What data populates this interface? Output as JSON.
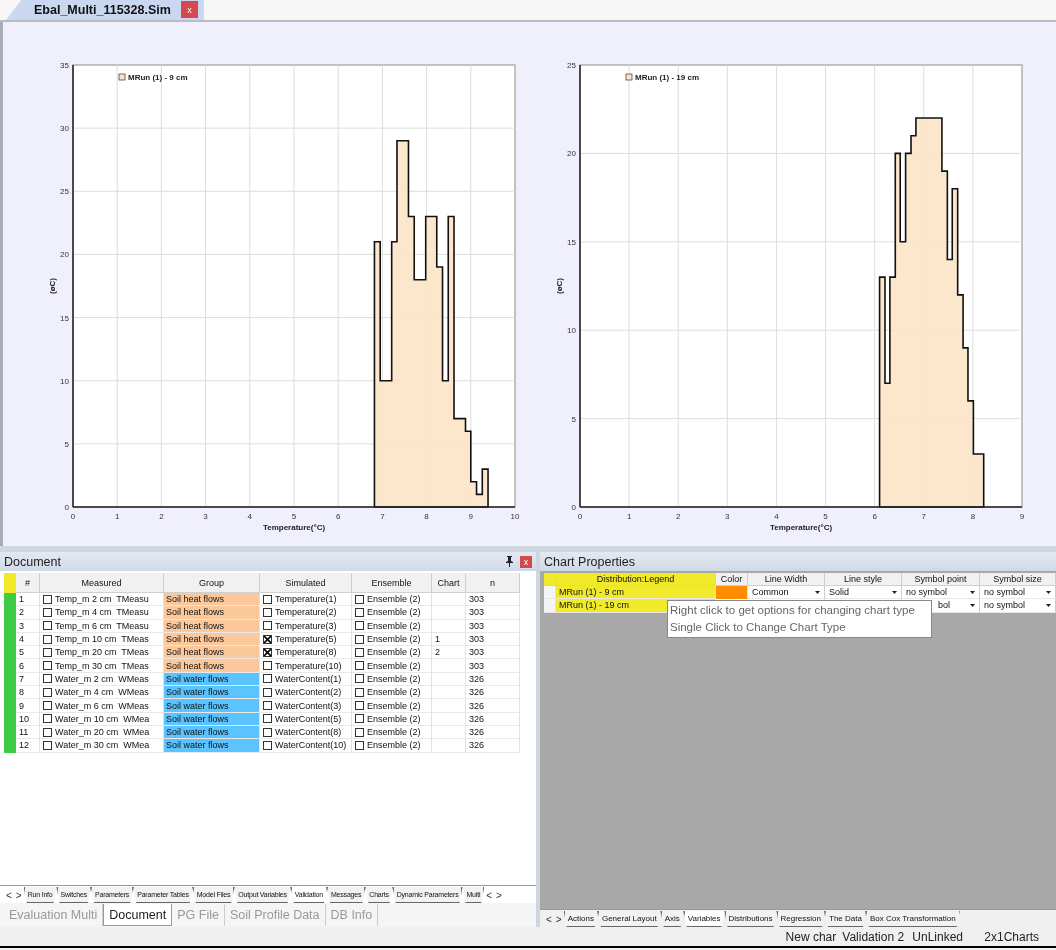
{
  "document_tab": {
    "title": "Ebal_Multi_115328.Sim",
    "close": "x"
  },
  "charts": [
    {
      "chart_data": {
        "type": "area",
        "xlabel": "Temperature(°C)",
        "ylabel": "(øC)",
        "grid": true,
        "xlim": [
          0,
          10
        ],
        "ylim": [
          0,
          35
        ],
        "xticks": [
          0,
          1,
          2,
          3,
          4,
          5,
          6,
          7,
          8,
          9,
          10
        ],
        "yticks": [
          0,
          5,
          10,
          15,
          20,
          25,
          30,
          35
        ],
        "x": [
          6.82,
          6.95,
          7.08,
          7.21,
          7.33,
          7.46,
          7.59,
          7.72,
          7.85,
          7.98,
          8.1,
          8.23,
          8.36,
          8.49,
          8.62,
          8.75,
          8.88,
          9.0,
          9.13,
          9.26,
          9.39
        ],
        "series": [
          {
            "name": "MRun (1) - 9 cm",
            "color": "#fde4c6",
            "values": [
              21,
              10,
              10,
              21,
              29,
              29,
              23,
              18,
              18,
              23,
              23,
              19,
              10,
              23,
              7,
              7,
              6,
              2,
              1,
              3,
              3
            ]
          }
        ]
      }
    },
    {
      "chart_data": {
        "type": "area",
        "xlabel": "Temperature(°C)",
        "ylabel": "(øC)",
        "grid": true,
        "xlim": [
          0,
          9
        ],
        "ylim": [
          0,
          25
        ],
        "xticks": [
          0,
          1,
          2,
          3,
          4,
          5,
          6,
          7,
          8,
          9
        ],
        "yticks": [
          0,
          5,
          10,
          15,
          20,
          25
        ],
        "x": [
          6.1,
          6.21,
          6.31,
          6.42,
          6.52,
          6.63,
          6.74,
          6.84,
          6.95,
          7.05,
          7.16,
          7.27,
          7.37,
          7.48,
          7.58,
          7.69,
          7.8,
          7.9,
          8.01,
          8.11,
          8.22
        ],
        "series": [
          {
            "name": "MRun (1) - 19 cm",
            "color": "#fde4c6",
            "values": [
              13,
              7,
              13,
              20,
              15,
              20,
              21,
              22,
              22,
              22,
              22,
              22,
              19,
              14,
              18,
              12,
              9,
              6,
              3,
              3,
              3
            ]
          }
        ]
      }
    }
  ],
  "document_panel": {
    "title": "Document",
    "close": "x",
    "columns": [
      "#",
      "Measured",
      "Group",
      "Simulated",
      "Ensemble",
      "Chart",
      "n"
    ],
    "rows": [
      {
        "num": "1",
        "measured": "Temp_m 2 cm  TMeasu",
        "measured_checked": false,
        "group": "Soil heat flows",
        "color": "#fbc89b",
        "simulated": "Temperature(1)",
        "simulated_checked": false,
        "ensemble": "Ensemble (2)",
        "ensemble_checked": false,
        "chart": "",
        "n": "303"
      },
      {
        "num": "2",
        "measured": "Temp_m 4 cm  TMeasu",
        "measured_checked": false,
        "group": "Soil heat flows",
        "color": "#fbc89b",
        "simulated": "Temperature(2)",
        "simulated_checked": false,
        "ensemble": "Ensemble (2)",
        "ensemble_checked": false,
        "chart": "",
        "n": "303"
      },
      {
        "num": "3",
        "measured": "Temp_m 6 cm  TMeasu",
        "measured_checked": false,
        "group": "Soil heat flows",
        "color": "#fbc89b",
        "simulated": "Temperature(3)",
        "simulated_checked": false,
        "ensemble": "Ensemble (2)",
        "ensemble_checked": false,
        "chart": "",
        "n": "303"
      },
      {
        "num": "4",
        "measured": "Temp_m 10 cm  TMeas",
        "measured_checked": false,
        "group": "Soil heat flows",
        "color": "#fbc89b",
        "simulated": "Temperature(5)",
        "simulated_checked": true,
        "ensemble": "Ensemble (2)",
        "ensemble_checked": false,
        "chart": "1",
        "n": "303"
      },
      {
        "num": "5",
        "measured": "Temp_m 20 cm  TMeas",
        "measured_checked": false,
        "group": "Soil heat flows",
        "color": "#fbc89b",
        "simulated": "Temperature(8)",
        "simulated_checked": true,
        "ensemble": "Ensemble (2)",
        "ensemble_checked": false,
        "chart": "2",
        "n": "303"
      },
      {
        "num": "6",
        "measured": "Temp_m 30 cm  TMeas",
        "measured_checked": false,
        "group": "Soil heat flows",
        "color": "#fbc89b",
        "simulated": "Temperature(10)",
        "simulated_checked": false,
        "ensemble": "Ensemble (2)",
        "ensemble_checked": false,
        "chart": "",
        "n": "303"
      },
      {
        "num": "7",
        "measured": "Water_m 2 cm  WMeas",
        "measured_checked": false,
        "group": "Soil water flows",
        "color": "#5bc3ff",
        "simulated": "WaterContent(1)",
        "simulated_checked": false,
        "ensemble": "Ensemble (2)",
        "ensemble_checked": false,
        "chart": "",
        "n": "326"
      },
      {
        "num": "8",
        "measured": "Water_m 4 cm  WMeas",
        "measured_checked": false,
        "group": "Soil water flows",
        "color": "#5bc3ff",
        "simulated": "WaterContent(2)",
        "simulated_checked": false,
        "ensemble": "Ensemble (2)",
        "ensemble_checked": false,
        "chart": "",
        "n": "326"
      },
      {
        "num": "9",
        "measured": "Water_m 6 cm  WMeas",
        "measured_checked": false,
        "group": "Soil water flows",
        "color": "#5bc3ff",
        "simulated": "WaterContent(3)",
        "simulated_checked": false,
        "ensemble": "Ensemble (2)",
        "ensemble_checked": false,
        "chart": "",
        "n": "326"
      },
      {
        "num": "10",
        "measured": "Water_m 10 cm  WMea",
        "measured_checked": false,
        "group": "Soil water flows",
        "color": "#5bc3ff",
        "simulated": "WaterContent(5)",
        "simulated_checked": false,
        "ensemble": "Ensemble (2)",
        "ensemble_checked": false,
        "chart": "",
        "n": "326"
      },
      {
        "num": "11",
        "measured": "Water_m 20 cm  WMea",
        "measured_checked": false,
        "group": "Soil water flows",
        "color": "#5bc3ff",
        "simulated": "WaterContent(8)",
        "simulated_checked": false,
        "ensemble": "Ensemble (2)",
        "ensemble_checked": false,
        "chart": "",
        "n": "326"
      },
      {
        "num": "12",
        "measured": "Water_m 30 cm  WMea",
        "measured_checked": false,
        "group": "Soil water flows",
        "color": "#5bc3ff",
        "simulated": "WaterContent(10)",
        "simulated_checked": false,
        "ensemble": "Ensemble (2)",
        "ensemble_checked": false,
        "chart": "",
        "n": "326"
      }
    ],
    "sheet_nav": [
      "<",
      ">"
    ],
    "sheet_tabs": [
      {
        "label": "Run Info",
        "selected": false
      },
      {
        "label": "Switches",
        "selected": false
      },
      {
        "label": "Parameters",
        "selected": false
      },
      {
        "label": "Parameter Tables",
        "selected": false
      },
      {
        "label": "Model Files",
        "selected": false
      },
      {
        "label": "Output Variables",
        "selected": false
      },
      {
        "label": "Validation",
        "selected": true
      },
      {
        "label": "Messages",
        "selected": false
      },
      {
        "label": "Charts",
        "selected": false
      },
      {
        "label": "Dynamic Parameters",
        "selected": false
      },
      {
        "label": "Multi",
        "selected": false
      }
    ],
    "sheet_end_nav": [
      "<",
      ">"
    ],
    "panel_tabs": [
      {
        "label": "Evaluation Multi",
        "selected": false
      },
      {
        "label": "Document",
        "selected": true
      },
      {
        "label": "PG File",
        "selected": false
      },
      {
        "label": "Soil Profile Data",
        "selected": false
      },
      {
        "label": "DB Info",
        "selected": false
      }
    ]
  },
  "chart_properties": {
    "title": "Chart Properties",
    "columns": [
      "Distribution:Legend",
      "Color",
      "Line Width",
      "Line style",
      "Symbol point",
      "Symbol size"
    ],
    "rows": [
      {
        "legend": "MRun (1) - 9 cm",
        "color": "#ff8c00",
        "line_width": "Common",
        "line_style": "Solid",
        "symbol_point": "no symbol",
        "symbol_size": "no symbol"
      },
      {
        "legend": "MRun (1) - 19 cm",
        "symbol_point": "bol",
        "symbol_size": "no symbol"
      }
    ],
    "tooltip": [
      "Right click to get options for changing chart type",
      "Single Click to Change Chart Type"
    ],
    "tab_nav": [
      "<",
      ">"
    ],
    "tabs": [
      {
        "label": "Actions",
        "selected": false
      },
      {
        "label": "General Layout",
        "selected": false
      },
      {
        "label": "Axis",
        "selected": false
      },
      {
        "label": "Variables",
        "selected": true
      },
      {
        "label": "Distributions",
        "selected": false
      },
      {
        "label": "Regression",
        "selected": false
      },
      {
        "label": "The Data",
        "selected": false
      },
      {
        "label": "Box Cox Transformation",
        "selected": false
      }
    ]
  },
  "status_bar": [
    "New char",
    "Validation 2",
    "UnLinked",
    "2x1Charts"
  ]
}
